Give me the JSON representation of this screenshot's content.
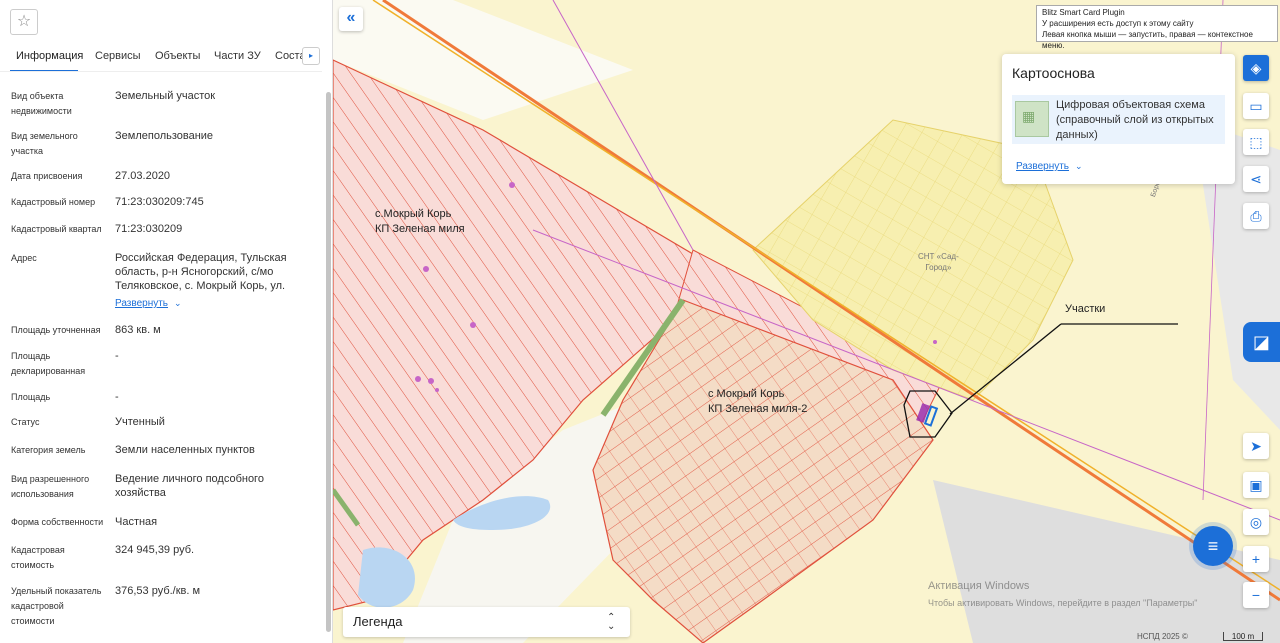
{
  "panel": {
    "tabs": [
      {
        "label": "Информация"
      },
      {
        "label": "Сервисы"
      },
      {
        "label": "Объекты"
      },
      {
        "label": "Части ЗУ"
      },
      {
        "label": "Соста"
      }
    ],
    "fields": [
      {
        "label": "Вид объекта недвижимости",
        "value": "Земельный участок"
      },
      {
        "label": "Вид земельного участка",
        "value": "Землепользование"
      },
      {
        "label": "Дата присвоения",
        "value": "27.03.2020"
      },
      {
        "label": "Кадастровый номер",
        "value": "71:23:030209:745"
      },
      {
        "label": "Кадастровый квартал",
        "value": "71:23:030209"
      },
      {
        "label": "Адрес",
        "value": "Российская Федерация, Тульская область, р-н Ясногорский, с/мо Теляковское, с. Мокрый Корь, ул."
      },
      {
        "label": "Площадь уточненная",
        "value": "863 кв. м"
      },
      {
        "label": "Площадь декларированная",
        "value": "-"
      },
      {
        "label": "Площадь",
        "value": "-"
      },
      {
        "label": "Статус",
        "value": "Учтенный"
      },
      {
        "label": "Категория земель",
        "value": "Земли населенных пунктов"
      },
      {
        "label": "Вид разрешенного использования",
        "value": "Ведение личного подсобного хозяйства"
      },
      {
        "label": "Форма собственности",
        "value": "Частная"
      },
      {
        "label": "Кадастровая стоимость",
        "value": "324 945,39 руб."
      },
      {
        "label": "Удельный показатель кадастровой стоимости",
        "value": "376,53 руб./кв. м"
      }
    ],
    "address_expand": "Развернуть"
  },
  "plugin": {
    "line1": "Blitz Smart Card Plugin",
    "line2": "У расширения есть доступ к этому сайту",
    "line3": "Левая кнопка мыши — запустить, правая — контекстное меню."
  },
  "basemap": {
    "title": "Картооснова",
    "item": "Цифровая объектовая схема (справочный слой из открытых данных)",
    "expand": "Развернуть"
  },
  "map": {
    "label_west_1": "с.Мокрый Корь",
    "label_west_2": "КП Зеленая миля",
    "label_center_1": "с Мокрый Корь",
    "label_center_2": "КП Зеленая миля-2",
    "label_snt_1": "СНТ «Сад-",
    "label_snt_2": "Город»",
    "label_road": "Боровой пер.",
    "label_parcels": "Участки",
    "watermark_1": "Активация Windows",
    "watermark_2": "Чтобы активировать Windows, перейдите в раздел \"Параметры\"",
    "attribution": "НСПД 2025 ©",
    "scale": "100 m"
  },
  "legend": {
    "label": "Легенда"
  },
  "colors": {
    "accent": "#1c6fd8",
    "map_background": "#faf4cf",
    "parcel_pink": "#f9dcd8",
    "parcel_outline": "#e0503c",
    "parcel_orange": "#f4dcc6",
    "snt_yellow": "#f7efb0",
    "water": "#b9d6f2",
    "green_strip": "#8ab36c",
    "selected_parcel": "#9b2fae"
  }
}
